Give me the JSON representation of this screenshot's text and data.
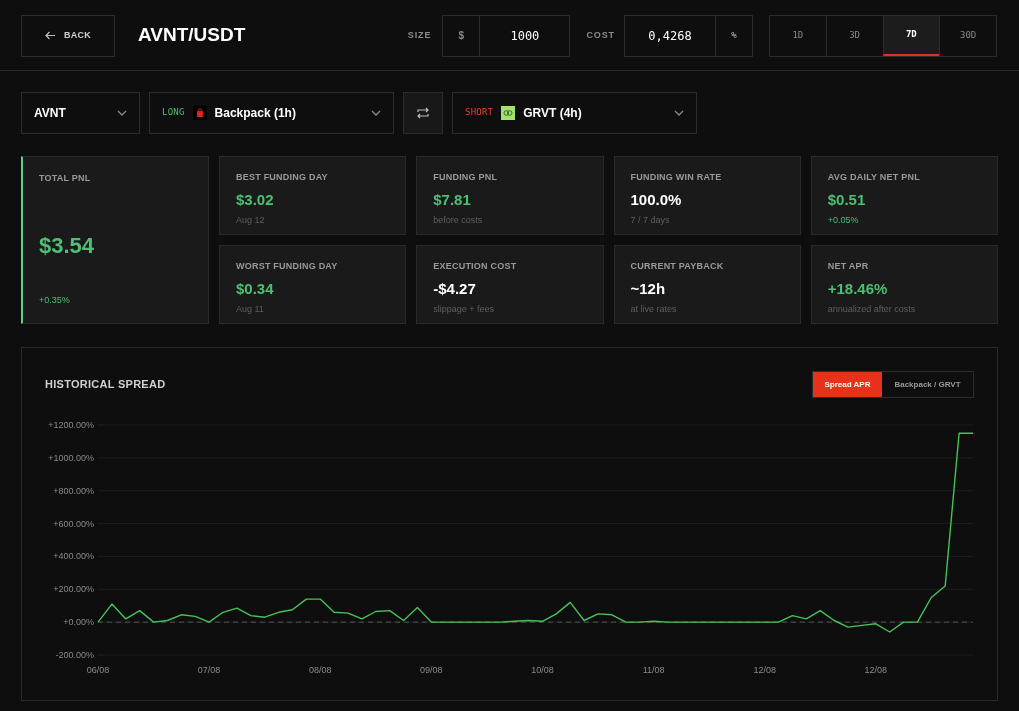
{
  "header": {
    "back_button": "BACK",
    "pair": "AVNT/USDT",
    "size": {
      "label": "SIZE",
      "prefix": "$",
      "value": "1000"
    },
    "cost": {
      "label": "COST",
      "value": "0,4268",
      "suffix": "%"
    },
    "timeframes": [
      {
        "label": "1D",
        "selected": false
      },
      {
        "label": "3D",
        "selected": false
      },
      {
        "label": "7D",
        "selected": true
      },
      {
        "label": "30D",
        "selected": false
      }
    ]
  },
  "selectors": {
    "asset": "AVNT",
    "long": {
      "side": "LONG",
      "exchange": "Backpack (1h)"
    },
    "short": {
      "side": "SHORT",
      "exchange": "GRVT (4h)"
    }
  },
  "total_pnl": {
    "label": "TOTAL PNL",
    "value": "$3.54",
    "sub": "+0.35%"
  },
  "stats": [
    {
      "label": "BEST FUNDING DAY",
      "value": "$3.02",
      "sub": "Aug 12",
      "value_positive": true,
      "sub_positive": false
    },
    {
      "label": "FUNDING PNL",
      "value": "$7.81",
      "sub": "before costs",
      "value_positive": true,
      "sub_positive": false
    },
    {
      "label": "FUNDING WIN RATE",
      "value": "100.0%",
      "sub": "7 / 7 days",
      "value_positive": false,
      "sub_positive": false
    },
    {
      "label": "AVG DAILY NET PNL",
      "value": "$0.51",
      "sub": "+0.05%",
      "value_positive": true,
      "sub_positive": true
    },
    {
      "label": "WORST FUNDING DAY",
      "value": "$0.34",
      "sub": "Aug 11",
      "value_positive": true,
      "sub_positive": false
    },
    {
      "label": "EXECUTION COST",
      "value": "-$4.27",
      "sub": "slippage + fees",
      "value_positive": false,
      "sub_positive": false
    },
    {
      "label": "CURRENT PAYBACK",
      "value": "~12h",
      "sub": "at live rates",
      "value_positive": false,
      "sub_positive": false
    },
    {
      "label": "NET APR",
      "value": "+18.46%",
      "sub": "annualized after costs",
      "value_positive": true,
      "sub_positive": false
    }
  ],
  "chart_panel": {
    "title": "HISTORICAL SPREAD",
    "toggles": [
      {
        "label": "Spread APR",
        "selected": true
      },
      {
        "label": "Backpack / GRVT",
        "selected": false
      }
    ],
    "chart_data": {
      "type": "line",
      "ylim": [
        -200,
        1200
      ],
      "categories": [
        "06/08",
        null,
        null,
        null,
        null,
        null,
        null,
        null,
        "07/08",
        null,
        null,
        null,
        null,
        null,
        null,
        null,
        "08/08",
        null,
        null,
        null,
        null,
        null,
        null,
        null,
        "09/08",
        null,
        null,
        null,
        null,
        null,
        null,
        null,
        "10/08",
        null,
        null,
        null,
        null,
        null,
        null,
        null,
        "11/08",
        null,
        null,
        null,
        null,
        null,
        null,
        null,
        "12/08",
        null,
        null,
        null,
        null,
        null,
        null,
        null,
        "12/08",
        null,
        null,
        null,
        null,
        null,
        null,
        null
      ],
      "grid": true,
      "ref_lines": [
        {
          "axis": "y",
          "value": 0,
          "color": "#555555"
        }
      ],
      "yticks": [
        {
          "value": 1200,
          "label": "+1200.00%"
        },
        {
          "value": 1000,
          "label": "+1000.00%"
        },
        {
          "value": 800,
          "label": "+800.00%"
        },
        {
          "value": 600,
          "label": "+600.00%"
        },
        {
          "value": 400,
          "label": "+400.00%"
        },
        {
          "value": 200,
          "label": "+200.00%"
        },
        {
          "value": 0,
          "label": "+0.00%"
        },
        {
          "value": -200,
          "label": "-200.00%"
        }
      ],
      "series": [
        {
          "color": "#45c25a",
          "values": [
            0,
            110,
            20,
            70,
            0,
            10,
            45,
            35,
            0,
            60,
            85,
            40,
            30,
            60,
            75,
            140,
            140,
            60,
            55,
            20,
            65,
            70,
            10,
            90,
            0,
            0,
            0,
            0,
            0,
            0,
            5,
            10,
            5,
            50,
            120,
            10,
            50,
            45,
            0,
            0,
            5,
            0,
            0,
            0,
            0,
            0,
            0,
            0,
            0,
            0,
            40,
            20,
            70,
            10,
            -30,
            -20,
            -10,
            -60,
            0,
            0,
            150,
            220,
            1150,
            1150
          ]
        }
      ]
    }
  }
}
